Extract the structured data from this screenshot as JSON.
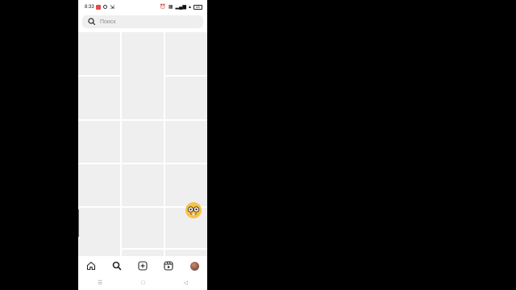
{
  "status_bar": {
    "time": "8:33",
    "battery": "65"
  },
  "search": {
    "placeholder": "Поиск"
  },
  "icons": {
    "search": "search-icon",
    "home": "home-icon",
    "explore": "search-icon",
    "create": "plus-square-icon",
    "reels": "reels-icon",
    "profile": "avatar",
    "floating": "nerd-face-emoji-icon"
  },
  "colors": {
    "placeholder_tile": "#efefef",
    "background": "#ffffff"
  },
  "system_nav": {
    "recents": "☰",
    "home": "□",
    "back": "◁"
  }
}
